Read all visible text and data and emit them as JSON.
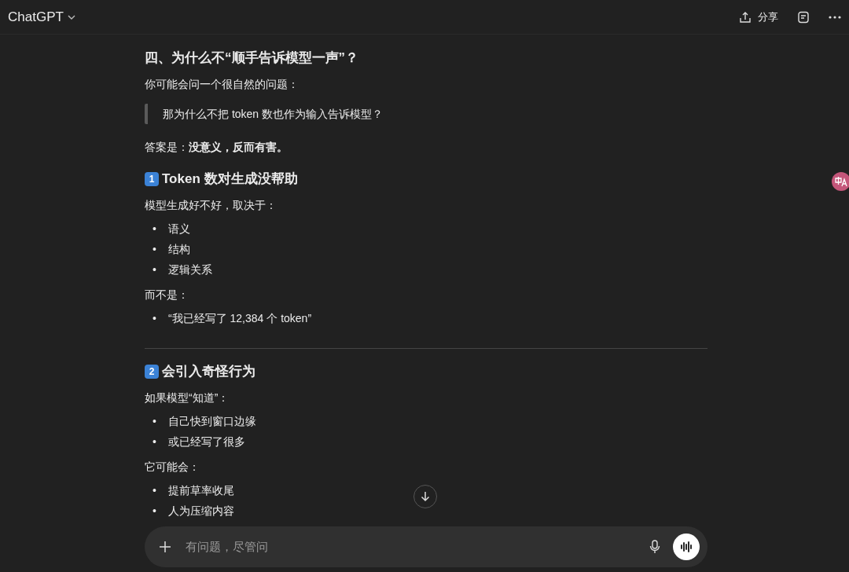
{
  "header": {
    "title": "ChatGPT",
    "share_label": "分享"
  },
  "blocks": [
    {
      "kind": "heading",
      "text": "四、为什么不“顺手告诉模型一声”？"
    },
    {
      "kind": "paragraph",
      "text": "你可能会问一个很自然的问题："
    },
    {
      "kind": "quote",
      "text": "那为什么不把 token 数也作为输入告诉模型？"
    },
    {
      "kind": "paragraph",
      "text": "答案是：**没意义，反而有害。**"
    },
    {
      "kind": "heading",
      "marker": "1",
      "text": "Token 数对生成没帮助"
    },
    {
      "kind": "paragraph",
      "text": "模型生成好不好，取决于："
    },
    {
      "kind": "list",
      "marker": "•",
      "items": [
        "语义",
        "结构",
        "逻辑关系"
      ]
    },
    {
      "kind": "paragraph",
      "text": "而不是："
    },
    {
      "kind": "list",
      "marker": "•",
      "items": [
        "“我已经写了 12,384 个 token”"
      ]
    },
    {
      "kind": "rule"
    },
    {
      "kind": "heading",
      "marker": "2",
      "text": "会引入奇怪行为"
    },
    {
      "kind": "paragraph",
      "text": "如果模型“知道”："
    },
    {
      "kind": "list",
      "marker": "•",
      "items": [
        "自己快到窗口边缘",
        "或已经写了很多"
      ]
    },
    {
      "kind": "paragraph",
      "text": "它可能会："
    },
    {
      "kind": "list",
      "marker": "•",
      "items": [
        "提前草率收尾",
        "人为压缩内容"
      ]
    }
  ],
  "composer": {
    "placeholder": "有问题，尽管问"
  }
}
